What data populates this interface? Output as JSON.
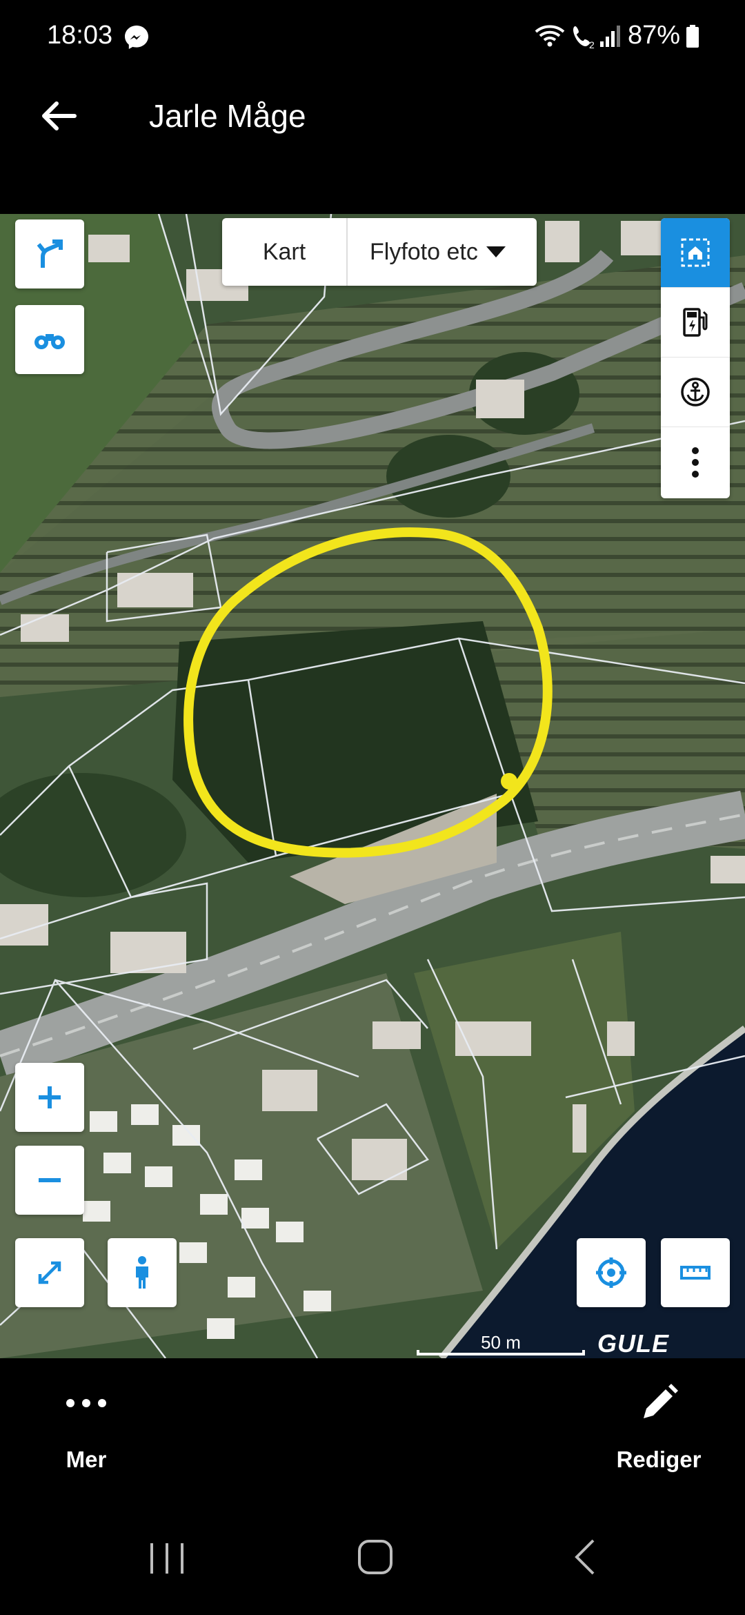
{
  "status_bar": {
    "time": "18:03",
    "battery": "87%",
    "icons": [
      "messenger-icon",
      "wifi-icon",
      "wifi-call-icon",
      "signal-icon",
      "battery-icon"
    ]
  },
  "app_bar": {
    "title": "Jarle Måge",
    "back_icon": "arrow-left-icon"
  },
  "map": {
    "layer_options": {
      "kart": "Kart",
      "flyfoto": "Flyfoto etc"
    },
    "left_tools": [
      "route-icon",
      "binoculars-icon"
    ],
    "right_tools": [
      "home-select-icon",
      "charging-station-icon",
      "anchor-icon",
      "more-vertical-icon"
    ],
    "zoom": [
      "plus-icon",
      "minus-icon"
    ],
    "extra_tools": [
      "fullscreen-icon",
      "person-icon",
      "locate-icon",
      "ruler-icon"
    ],
    "scale_label": "50 m",
    "brand": "GULE SIDER",
    "highlight_color": "#f2e51c",
    "accent_color": "#1a8fe0"
  },
  "bottom_actions": {
    "more_label": "Mer",
    "edit_label": "Rediger"
  },
  "nav_bar": [
    "recents-icon",
    "home-icon",
    "back-icon"
  ]
}
